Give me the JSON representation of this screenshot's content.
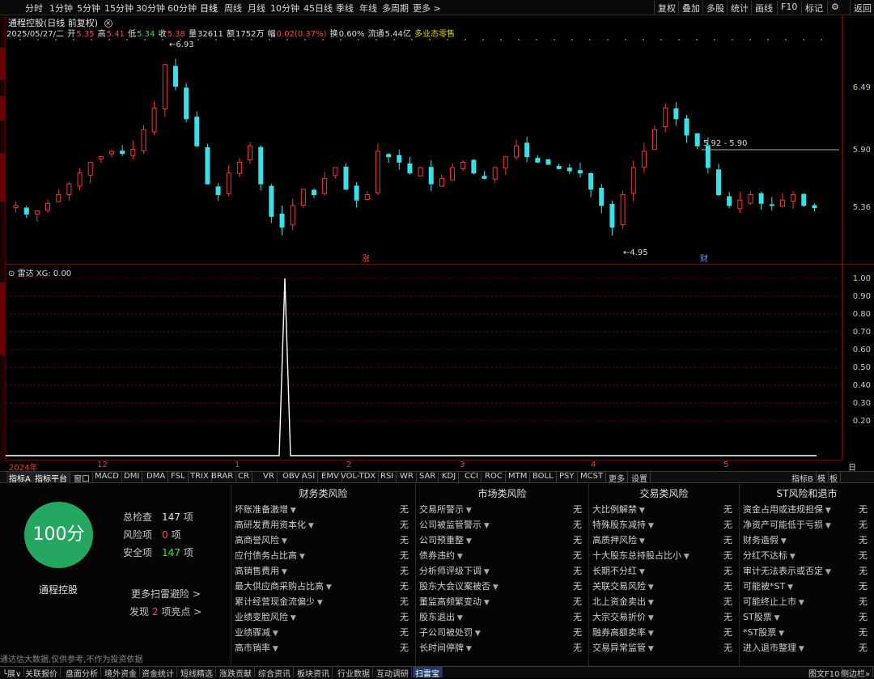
{
  "toolbar": {
    "timeframes": [
      "分时",
      "1分钟",
      "5分钟",
      "15分钟",
      "30分钟",
      "60分钟",
      "日线",
      "周线",
      "月线",
      "10分钟",
      "45日线",
      "季线",
      "年线",
      "多周期",
      "更多 >"
    ],
    "active_timeframe": "日线",
    "right_buttons": [
      "复权",
      "叠加",
      "多股",
      "统计",
      "画线",
      "F10",
      "标记",
      "返回"
    ]
  },
  "chart_title": "通程控股(日线 前复权)",
  "info": {
    "date": "2025/05/27/二",
    "open_label": "开",
    "open": "5.35",
    "high_label": "高",
    "high": "5.41",
    "low_label": "低",
    "low": "5.34",
    "close_label": "收",
    "close": "5.38",
    "volume_label": "量",
    "volume": "32611",
    "amount_label": "额",
    "amount": "1752万",
    "change_label": "幅",
    "change": "0.02(0.37%)",
    "turnover_label": "换",
    "turnover": "0.60%",
    "float_label": "流通",
    "float_cap": "5.44亿",
    "sector": "多业态零售"
  },
  "price_axis": [
    "6.49",
    "5.90",
    "5.36"
  ],
  "annotations": {
    "high_marker": "6.93",
    "low_marker": "4.95",
    "range_line": "5.92 - 5.90",
    "zhang_tag": "涨",
    "cai_tag": "财"
  },
  "radar": {
    "title": "雷达 XG: 0.00",
    "scale": [
      "1.00",
      "0.90",
      "0.80",
      "0.70",
      "0.60",
      "0.50",
      "0.40",
      "0.30",
      "0.20"
    ]
  },
  "date_axis": {
    "labels": [
      "2024年",
      "12",
      "1",
      "2",
      "3",
      "4",
      "5"
    ],
    "day_label": "日线"
  },
  "indicator_tabs": [
    "指标A",
    "指标平台",
    "窗口",
    "MACD",
    "DMI",
    "DMA",
    "FSL",
    "TRIX",
    "BRAR",
    "CR",
    "VR",
    "OBV",
    "ASI",
    "EMV",
    "VOL-TDX",
    "RSI",
    "WR",
    "SAR",
    "KDJ",
    "CCI",
    "ROC",
    "MTM",
    "BOLL",
    "PSY",
    "MCST",
    "更多",
    "设置"
  ],
  "indicator_right": [
    "指标B",
    "模",
    "板"
  ],
  "summary": {
    "score": "100分",
    "stock_name": "通程控股",
    "total_label": "总检查",
    "total": "147",
    "total_unit": "项",
    "risk_label": "风险项",
    "risk": "0",
    "risk_unit": "项",
    "safe_label": "安全项",
    "safe": "147",
    "safe_unit": "项",
    "more_link": "更多扫雷避险 >",
    "found_prefix": "发现",
    "found_count": "2",
    "found_suffix": "项亮点 >"
  },
  "risk_columns": [
    {
      "title": "财务类风险",
      "items": [
        [
          "坏账准备激增",
          "无"
        ],
        [
          "高研发费用资本化",
          "无"
        ],
        [
          "高商誉风险",
          "无"
        ],
        [
          "应付债务占比高",
          "无"
        ],
        [
          "高销售费用",
          "无"
        ],
        [
          "最大供应商采购占比高",
          "无"
        ],
        [
          "累计经营现金流偏少",
          "无"
        ],
        [
          "业绩变脸风险",
          "无"
        ],
        [
          "业绩骤减",
          "无"
        ],
        [
          "高市销率",
          "无"
        ]
      ]
    },
    {
      "title": "市场类风险",
      "items": [
        [
          "交易所警示",
          "无"
        ],
        [
          "公司被监管警示",
          "无"
        ],
        [
          "公司预重整",
          "无"
        ],
        [
          "债券违约",
          "无"
        ],
        [
          "分析师评级下调",
          "无"
        ],
        [
          "股东大会议案被否",
          "无"
        ],
        [
          "董监高频繁变动",
          "无"
        ],
        [
          "股东退出",
          "无"
        ],
        [
          "子公司被处罚",
          "无"
        ],
        [
          "长时间停牌",
          "无"
        ]
      ]
    },
    {
      "title": "交易类风险",
      "items": [
        [
          "大比例解禁",
          "无"
        ],
        [
          "特殊股东减持",
          "无"
        ],
        [
          "高质押风险",
          "无"
        ],
        [
          "十大股东总持股占比小",
          "无"
        ],
        [
          "长期不分红",
          "无"
        ],
        [
          "关联交易风险",
          "无"
        ],
        [
          "北上资金卖出",
          "无"
        ],
        [
          "大宗交易折价",
          "无"
        ],
        [
          "融券高额卖率",
          "无"
        ],
        [
          "交易异常监管",
          "无"
        ]
      ]
    },
    {
      "title": "ST风险和退市",
      "items": [
        [
          "资金占用或违规担保",
          "无"
        ],
        [
          "净资产可能低于亏损",
          "无"
        ],
        [
          "财务造假",
          "无"
        ],
        [
          "分红不达标",
          "无"
        ],
        [
          "审计无法表示或否定",
          "无"
        ],
        [
          "可能被*ST",
          "无"
        ],
        [
          "可能终止上市",
          "无"
        ],
        [
          "ST股票",
          "无"
        ],
        [
          "*ST股票",
          "无"
        ],
        [
          "进入退市整理",
          "无"
        ]
      ]
    }
  ],
  "disclaimer": "通达信大数据,仅供参考,不作为投资依据",
  "bottom_tabs": [
    "╰展∨",
    "关联报价",
    "盘面分析",
    "境外资金",
    "资金统计",
    "短线精选",
    "涨跌贡献",
    "综合资讯",
    "板块资讯",
    "行业数据",
    "互动调研",
    "扫雷宝"
  ],
  "bottom_right": [
    "图文F10",
    "侧边栏»"
  ],
  "colors": {
    "up": "#ff3030",
    "down": "#38e0e8",
    "accent_red": "#8a0000",
    "score_green": "#24a861"
  }
}
